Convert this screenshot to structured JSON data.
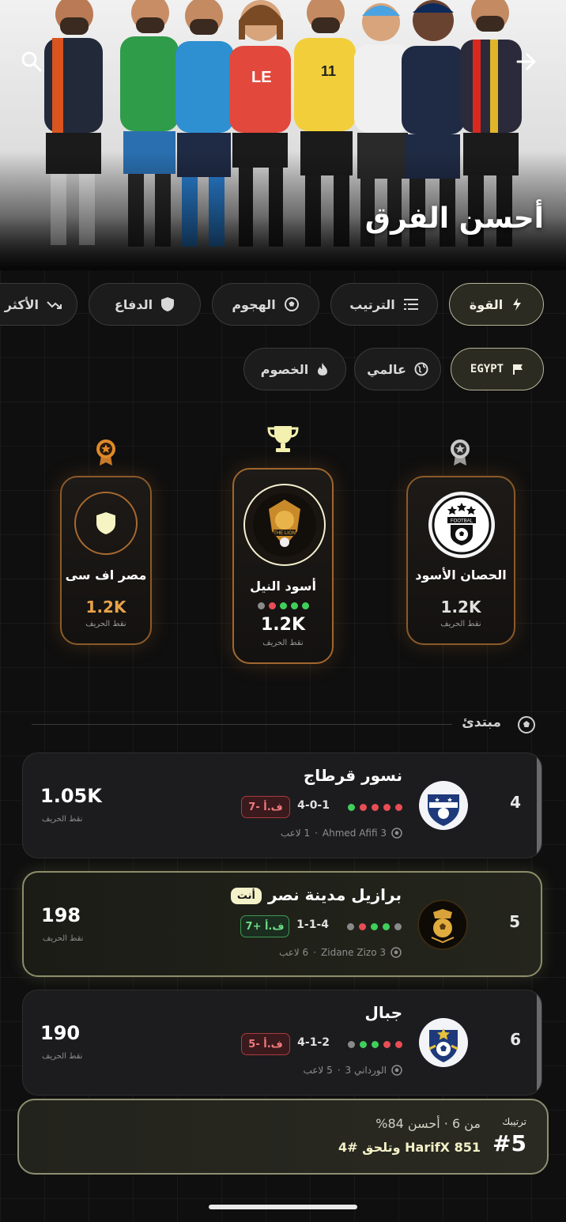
{
  "header": {
    "title": "أحسن الفرق"
  },
  "filters": {
    "metric_tabs": [
      {
        "label": "القوة",
        "icon": "bolt-icon",
        "active": true
      },
      {
        "label": "الترتيب",
        "icon": "list-icon",
        "active": false
      },
      {
        "label": "الهجوم",
        "icon": "ball-icon",
        "active": false
      },
      {
        "label": "الدفاع",
        "icon": "shield-icon",
        "active": false
      },
      {
        "label": "الأكثر ت",
        "icon": "trend-icon",
        "active": false
      }
    ],
    "scope_tabs": [
      {
        "label": "EGYPT",
        "icon": "flag-icon",
        "active": true
      },
      {
        "label": "عالمي",
        "icon": "globe-icon",
        "active": false
      },
      {
        "label": "الخصوم",
        "icon": "fire-icon",
        "active": false
      }
    ]
  },
  "podium": {
    "first": {
      "name": "أسود النيل",
      "points": "1.2K",
      "points_label": "نقط الحريف",
      "form": [
        "red",
        "green",
        "green",
        "green"
      ]
    },
    "second": {
      "name": "الحصان الأسود",
      "points": "1.2K",
      "points_label": "نقط الحريف"
    },
    "third": {
      "name": "مصر اف سی",
      "points": "1.2K",
      "points_label": "نقط الحريف"
    }
  },
  "section": {
    "label": "مبتدئ"
  },
  "rows": [
    {
      "rank": "4",
      "name": "نسور قرطاج",
      "form": [
        "red",
        "red",
        "red",
        "green",
        "red"
      ],
      "record": "4-0-1",
      "gd": "ف.أ -7",
      "captain": "Ahmed Afifi 3",
      "players": "1 لاعب",
      "points": "1.05K",
      "points_label": "نقط الحريف"
    },
    {
      "rank": "5",
      "name": "برازيل مدينة نصر",
      "you": "أنت",
      "form": [
        "gray",
        "green",
        "green",
        "red",
        "red"
      ],
      "record": "1-1-4",
      "gd": "ف.أ +7",
      "captain": "Zidane Zizo 3",
      "players": "6 لاعب",
      "points": "198",
      "points_label": "نقط الحريف"
    },
    {
      "rank": "6",
      "name": "جبال",
      "form": [
        "red",
        "green",
        "green",
        "red",
        "gray"
      ],
      "record": "4-1-2",
      "gd": "ف.أ -5",
      "captain": "الورداني 3",
      "players": "5 لاعب",
      "points": "190",
      "points_label": "نقط الحريف"
    }
  ],
  "summary": {
    "rank_label": "ترتيبك",
    "rank": "#5",
    "line1": "من 6 · أحسن 84%",
    "line2": "851 HarifX وتلحق #4"
  },
  "colors": {
    "accent": "#f4f2c8",
    "bronze": "#8a5a2b",
    "red": "#e84d55",
    "green": "#3fcf5b"
  }
}
